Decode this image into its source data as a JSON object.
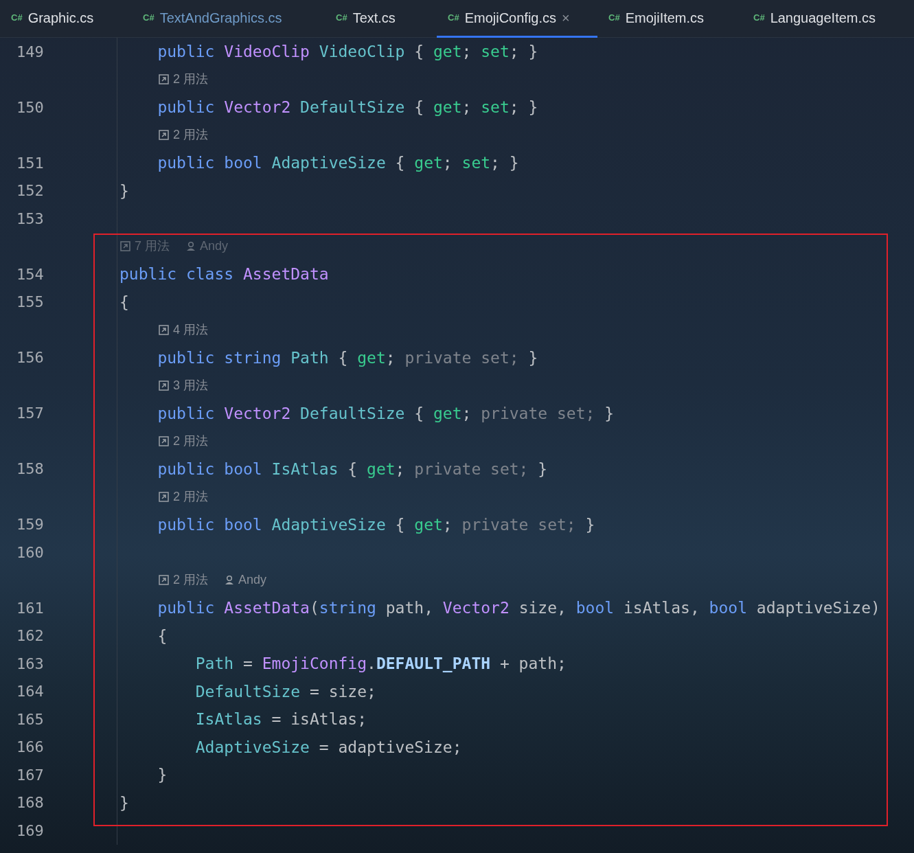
{
  "tabs": [
    {
      "icon_text": "C#",
      "label": "Graphic.cs",
      "color": "#dfe1e5",
      "selected": false
    },
    {
      "icon_text": "C#",
      "label": "TextAndGraphics.cs",
      "color": "#6f9bc8",
      "selected": false
    },
    {
      "icon_text": "C#",
      "label": "Text.cs",
      "color": "#dfe1e5",
      "selected": false
    },
    {
      "icon_text": "C#",
      "label": "EmojiConfig.cs",
      "color": "#dfe1e5",
      "selected": true,
      "close": "×"
    },
    {
      "icon_text": "C#",
      "label": "EmojiItem.cs",
      "color": "#dfe1e5",
      "selected": false
    },
    {
      "icon_text": "C#",
      "label": "LanguageItem.cs",
      "color": "#dfe1e5",
      "selected": false
    }
  ],
  "lines": [
    {
      "kind": "code",
      "number": "149",
      "tokens": [
        {
          "kind": "kw",
          "text": "    public "
        },
        {
          "kind": "type",
          "text": "VideoClip "
        },
        {
          "kind": "prop",
          "text": "VideoClip "
        },
        {
          "kind": "p",
          "text": "{ "
        },
        {
          "kind": "acc",
          "text": "get"
        },
        {
          "kind": "p",
          "text": "; "
        },
        {
          "kind": "acc",
          "text": "set"
        },
        {
          "kind": "p",
          "text": "; }"
        }
      ]
    },
    {
      "kind": "hint",
      "usages": "2 用法"
    },
    {
      "kind": "code",
      "number": "150",
      "tokens": [
        {
          "kind": "kw",
          "text": "    public "
        },
        {
          "kind": "type",
          "text": "Vector2 "
        },
        {
          "kind": "prop",
          "text": "DefaultSize "
        },
        {
          "kind": "p",
          "text": "{ "
        },
        {
          "kind": "acc",
          "text": "get"
        },
        {
          "kind": "p",
          "text": "; "
        },
        {
          "kind": "acc",
          "text": "set"
        },
        {
          "kind": "p",
          "text": "; }"
        }
      ]
    },
    {
      "kind": "hint",
      "usages": "2 用法"
    },
    {
      "kind": "code",
      "number": "151",
      "tokens": [
        {
          "kind": "kw",
          "text": "    public bool "
        },
        {
          "kind": "prop",
          "text": "AdaptiveSize "
        },
        {
          "kind": "p",
          "text": "{ "
        },
        {
          "kind": "acc",
          "text": "get"
        },
        {
          "kind": "p",
          "text": "; "
        },
        {
          "kind": "acc",
          "text": "set"
        },
        {
          "kind": "p",
          "text": "; }"
        }
      ]
    },
    {
      "kind": "code",
      "number": "152",
      "tokens": [
        {
          "kind": "p",
          "text": "}"
        }
      ]
    },
    {
      "kind": "code",
      "number": "153"
    },
    {
      "kind": "hint",
      "usages": "7 用法",
      "author": "Andy",
      "dim": true
    },
    {
      "kind": "code",
      "number": "154",
      "tokens": [
        {
          "kind": "kw",
          "text": "public class "
        },
        {
          "kind": "type",
          "text": "AssetData"
        }
      ]
    },
    {
      "kind": "code",
      "number": "155",
      "tokens": [
        {
          "kind": "p",
          "text": "{"
        }
      ]
    },
    {
      "kind": "hint",
      "usages": "4 用法"
    },
    {
      "kind": "code",
      "number": "156",
      "tokens": [
        {
          "kind": "kw",
          "text": "    public string "
        },
        {
          "kind": "prop",
          "text": "Path "
        },
        {
          "kind": "p",
          "text": "{ "
        },
        {
          "kind": "acc",
          "text": "get"
        },
        {
          "kind": "p",
          "text": "; "
        },
        {
          "kind": "dim",
          "text": "private set; "
        },
        {
          "kind": "p",
          "text": "}"
        }
      ]
    },
    {
      "kind": "hint",
      "usages": "3 用法"
    },
    {
      "kind": "code",
      "number": "157",
      "tokens": [
        {
          "kind": "kw",
          "text": "    public "
        },
        {
          "kind": "type",
          "text": "Vector2 "
        },
        {
          "kind": "prop",
          "text": "DefaultSize "
        },
        {
          "kind": "p",
          "text": "{ "
        },
        {
          "kind": "acc",
          "text": "get"
        },
        {
          "kind": "p",
          "text": "; "
        },
        {
          "kind": "dim",
          "text": "private set; "
        },
        {
          "kind": "p",
          "text": "}"
        }
      ]
    },
    {
      "kind": "hint",
      "usages": "2 用法"
    },
    {
      "kind": "code",
      "number": "158",
      "tokens": [
        {
          "kind": "kw",
          "text": "    public bool "
        },
        {
          "kind": "prop",
          "text": "IsAtlas "
        },
        {
          "kind": "p",
          "text": "{ "
        },
        {
          "kind": "acc",
          "text": "get"
        },
        {
          "kind": "p",
          "text": "; "
        },
        {
          "kind": "dim",
          "text": "private set; "
        },
        {
          "kind": "p",
          "text": "}"
        }
      ]
    },
    {
      "kind": "hint",
      "usages": "2 用法"
    },
    {
      "kind": "code",
      "number": "159",
      "tokens": [
        {
          "kind": "kw",
          "text": "    public bool "
        },
        {
          "kind": "prop",
          "text": "AdaptiveSize "
        },
        {
          "kind": "p",
          "text": "{ "
        },
        {
          "kind": "acc",
          "text": "get"
        },
        {
          "kind": "p",
          "text": "; "
        },
        {
          "kind": "dim",
          "text": "private set; "
        },
        {
          "kind": "p",
          "text": "}"
        }
      ]
    },
    {
      "kind": "code",
      "number": "160"
    },
    {
      "kind": "hint",
      "usages": "2 用法",
      "author": "Andy"
    },
    {
      "kind": "code",
      "number": "161",
      "tokens": [
        {
          "kind": "kw",
          "text": "    public "
        },
        {
          "kind": "type",
          "text": "AssetData"
        },
        {
          "kind": "p",
          "text": "("
        },
        {
          "kind": "kw",
          "text": "string "
        },
        {
          "kind": "p",
          "text": "path, "
        },
        {
          "kind": "type",
          "text": "Vector2 "
        },
        {
          "kind": "p",
          "text": "size, "
        },
        {
          "kind": "kw",
          "text": "bool "
        },
        {
          "kind": "p",
          "text": "isAtlas, "
        },
        {
          "kind": "kw",
          "text": "bool "
        },
        {
          "kind": "p",
          "text": "adaptiveSize)"
        }
      ]
    },
    {
      "kind": "code",
      "number": "162",
      "tokens": [
        {
          "kind": "p",
          "text": "    {"
        }
      ]
    },
    {
      "kind": "code",
      "number": "163",
      "tokens": [
        {
          "kind": "prop",
          "text": "        Path "
        },
        {
          "kind": "p",
          "text": "= "
        },
        {
          "kind": "type",
          "text": "EmojiConfig"
        },
        {
          "kind": "p",
          "text": "."
        },
        {
          "kind": "const",
          "text": "DEFAULT_PATH"
        },
        {
          "kind": "p",
          "text": " + path;"
        }
      ]
    },
    {
      "kind": "code",
      "number": "164",
      "tokens": [
        {
          "kind": "prop",
          "text": "        DefaultSize "
        },
        {
          "kind": "p",
          "text": "= size;"
        }
      ]
    },
    {
      "kind": "code",
      "number": "165",
      "tokens": [
        {
          "kind": "prop",
          "text": "        IsAtlas "
        },
        {
          "kind": "p",
          "text": "= isAtlas;"
        }
      ]
    },
    {
      "kind": "code",
      "number": "166",
      "tokens": [
        {
          "kind": "prop",
          "text": "        AdaptiveSize "
        },
        {
          "kind": "p",
          "text": "= adaptiveSize;"
        }
      ]
    },
    {
      "kind": "code",
      "number": "167",
      "tokens": [
        {
          "kind": "p",
          "text": "    }"
        }
      ]
    },
    {
      "kind": "code",
      "number": "168",
      "tokens": [
        {
          "kind": "p",
          "text": "}"
        }
      ]
    },
    {
      "kind": "code",
      "number": "169"
    }
  ]
}
